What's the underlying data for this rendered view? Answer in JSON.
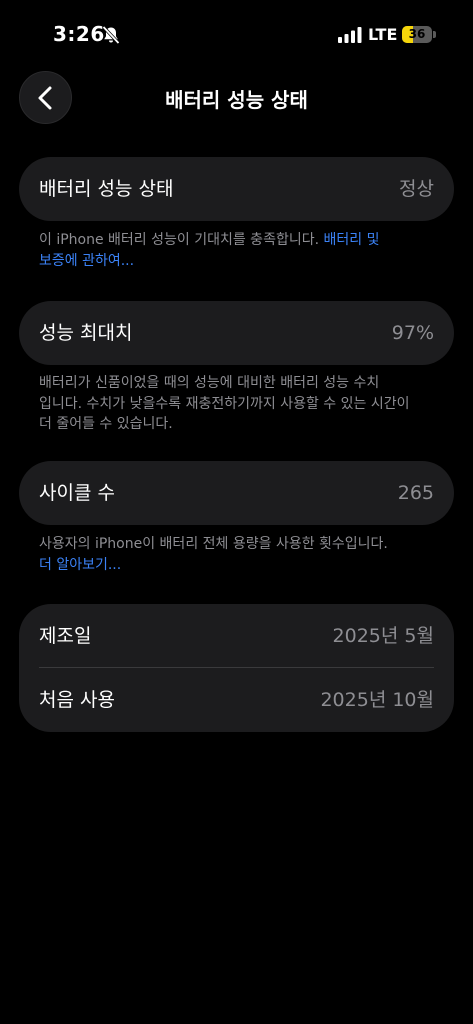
{
  "status_bar": {
    "time": "3:26",
    "network": "LTE",
    "battery_level": "36",
    "battery_fraction": 0.36,
    "silent_icon": "bell-slash-icon",
    "signal_icon": "signal-bars-icon"
  },
  "header": {
    "back_icon": "chevron-left-icon",
    "title": "배터리 성능 상태"
  },
  "battery_health": {
    "label": "배터리 성능 상태",
    "value": "정상",
    "note": "이 iPhone 배터리 성능이 기대치를 충족합니다.",
    "note_link_line1": "배터리 및",
    "note_link_line2": "보증에 관하여..."
  },
  "max_capacity": {
    "label": "성능 최대치",
    "value": "97%",
    "note_line1": "배터리가 신품이었을 때의 성능에 대비한 배터리 성능 수치",
    "note_line2": "입니다. 수치가 낮을수록 재충전하기까지 사용할 수 있는 시간이",
    "note_line3": "더 줄어들 수 있습니다."
  },
  "cycle_count": {
    "label": "사이클 수",
    "value": "265",
    "note": "사용자의 iPhone이 배터리 전체 용량을 사용한 횟수입니다.",
    "note_link": "더 알아보기..."
  },
  "dates": {
    "manufacture_label": "제조일",
    "manufacture_value": "2025년 5월",
    "first_use_label": "처음 사용",
    "first_use_value": "2025년 10월"
  },
  "colors": {
    "background": "#000000",
    "card": "#1c1c1e",
    "secondary_text": "#8e8e93",
    "link": "#3b82f6",
    "battery_accent": "#f5d50a"
  }
}
